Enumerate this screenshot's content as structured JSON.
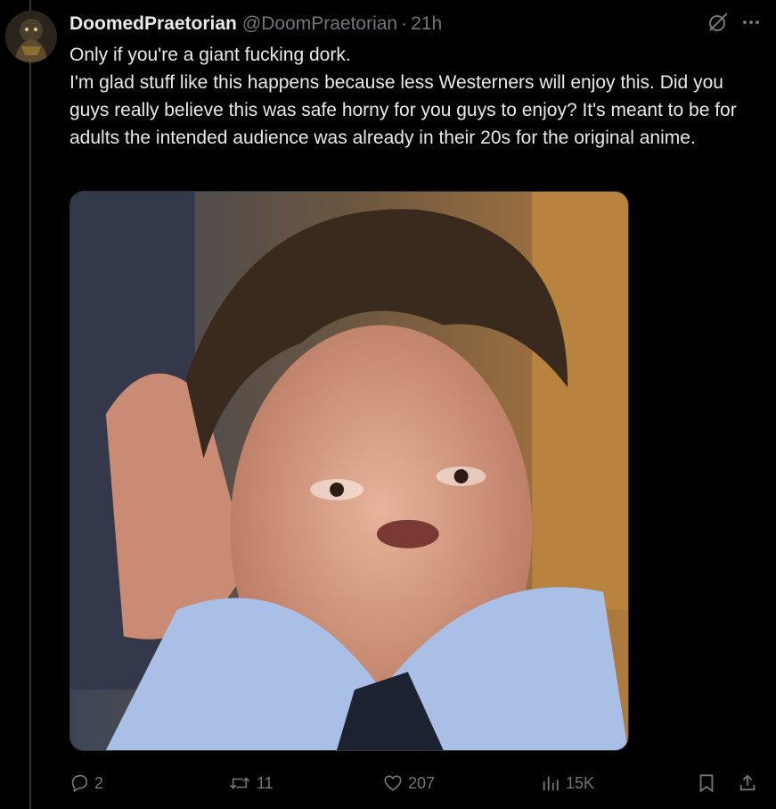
{
  "tweet": {
    "display_name": "DoomedPraetorian",
    "handle": "@DoomPraetorian",
    "separator": "·",
    "time": "21h",
    "lines": [
      "Only if you're a giant fucking dork.",
      "I'm glad stuff like this happens because less Westerners will enjoy this. Did you guys really believe this was safe horny for you guys to enjoy? It's meant to be for adults the intended audience was already in their 20s for the original anime."
    ]
  },
  "actions": {
    "reply_count": "2",
    "repost_count": "11",
    "like_count": "207",
    "view_count": "15K"
  },
  "icons": {
    "top": [
      "grok-icon",
      "more-icon"
    ],
    "actions": [
      "reply-icon",
      "repost-icon",
      "like-icon",
      "views-icon",
      "bookmark-icon",
      "share-icon"
    ]
  },
  "colors": {
    "background": "#000000",
    "text": "#e7e9ea",
    "muted": "#71767b"
  }
}
